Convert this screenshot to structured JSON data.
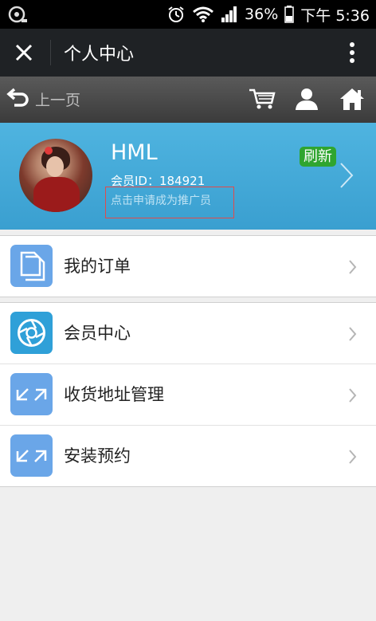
{
  "status_bar": {
    "battery": "36%",
    "time": "下午 5:36"
  },
  "title_bar": {
    "title": "个人中心"
  },
  "nav_bar": {
    "back_label": "上一页"
  },
  "profile": {
    "name": "HML",
    "member_id": "会员ID：184921",
    "apply_promoter": "点击申请成为推广员",
    "refresh_label": "刷新"
  },
  "menu_groups": [
    {
      "items": [
        {
          "label": "我的订单",
          "icon": "documents-icon",
          "color": "#6aa6e8"
        }
      ]
    },
    {
      "items": [
        {
          "label": "会员中心",
          "icon": "aperture-icon",
          "color": "#2fa0d8"
        },
        {
          "label": "收货地址管理",
          "icon": "arrows-icon",
          "color": "#6aa6e8"
        },
        {
          "label": "安装预约",
          "icon": "arrows-icon",
          "color": "#6aa6e8"
        }
      ]
    }
  ],
  "colors": {
    "profile_bg": "#4fb4e0",
    "refresh_bg": "#2fa52f",
    "apply_border": "#e24a4a"
  }
}
